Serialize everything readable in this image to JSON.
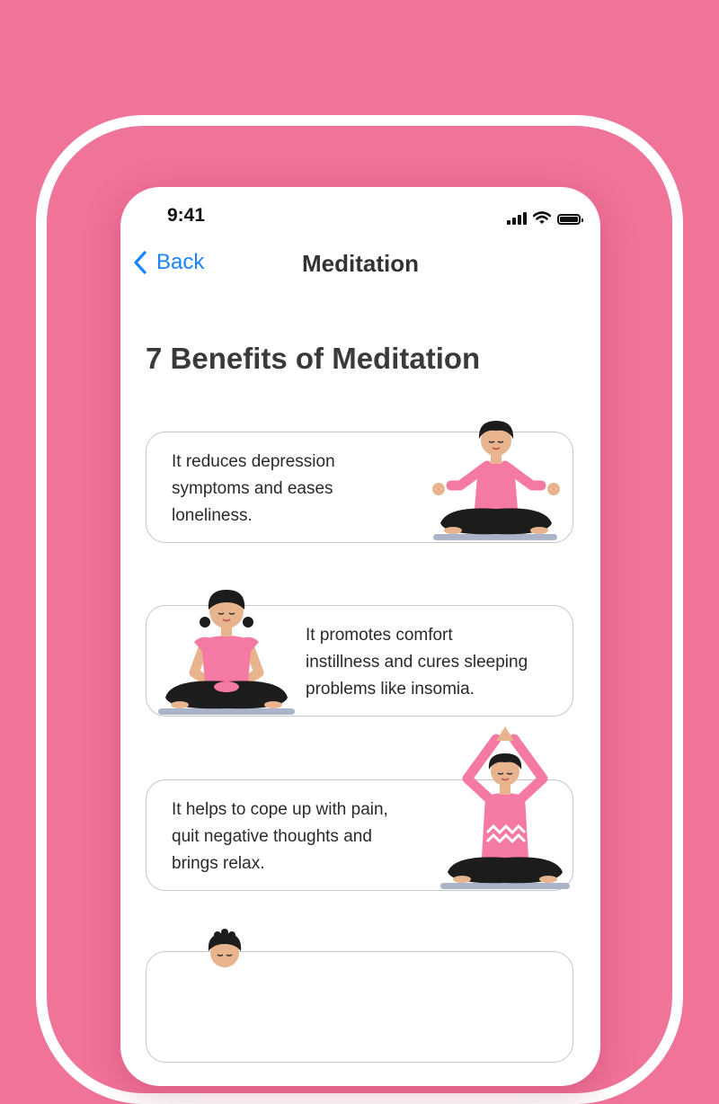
{
  "status_bar": {
    "time": "9:41"
  },
  "nav": {
    "back_label": "Back",
    "title": "Meditation"
  },
  "heading": "7 Benefits of Meditation",
  "benefits": [
    {
      "lines": [
        "It reduces depression",
        "symptoms and eases",
        "loneliness."
      ]
    },
    {
      "lines": [
        "It promotes comfort",
        "instillness and cures sleeping",
        "problems like insomia."
      ]
    },
    {
      "lines": [
        "It helps to cope up with pain,",
        "quit negative thoughts and",
        "brings relax."
      ]
    }
  ],
  "colors": {
    "background": "#f07398",
    "accent": "#1a84ff",
    "shirt": "#f57aa3",
    "skin": "#e8b48e",
    "hair": "#1c1c1c"
  },
  "icons": [
    "cellular-signal-icon",
    "wifi-icon",
    "battery-icon",
    "chevron-left-icon"
  ]
}
